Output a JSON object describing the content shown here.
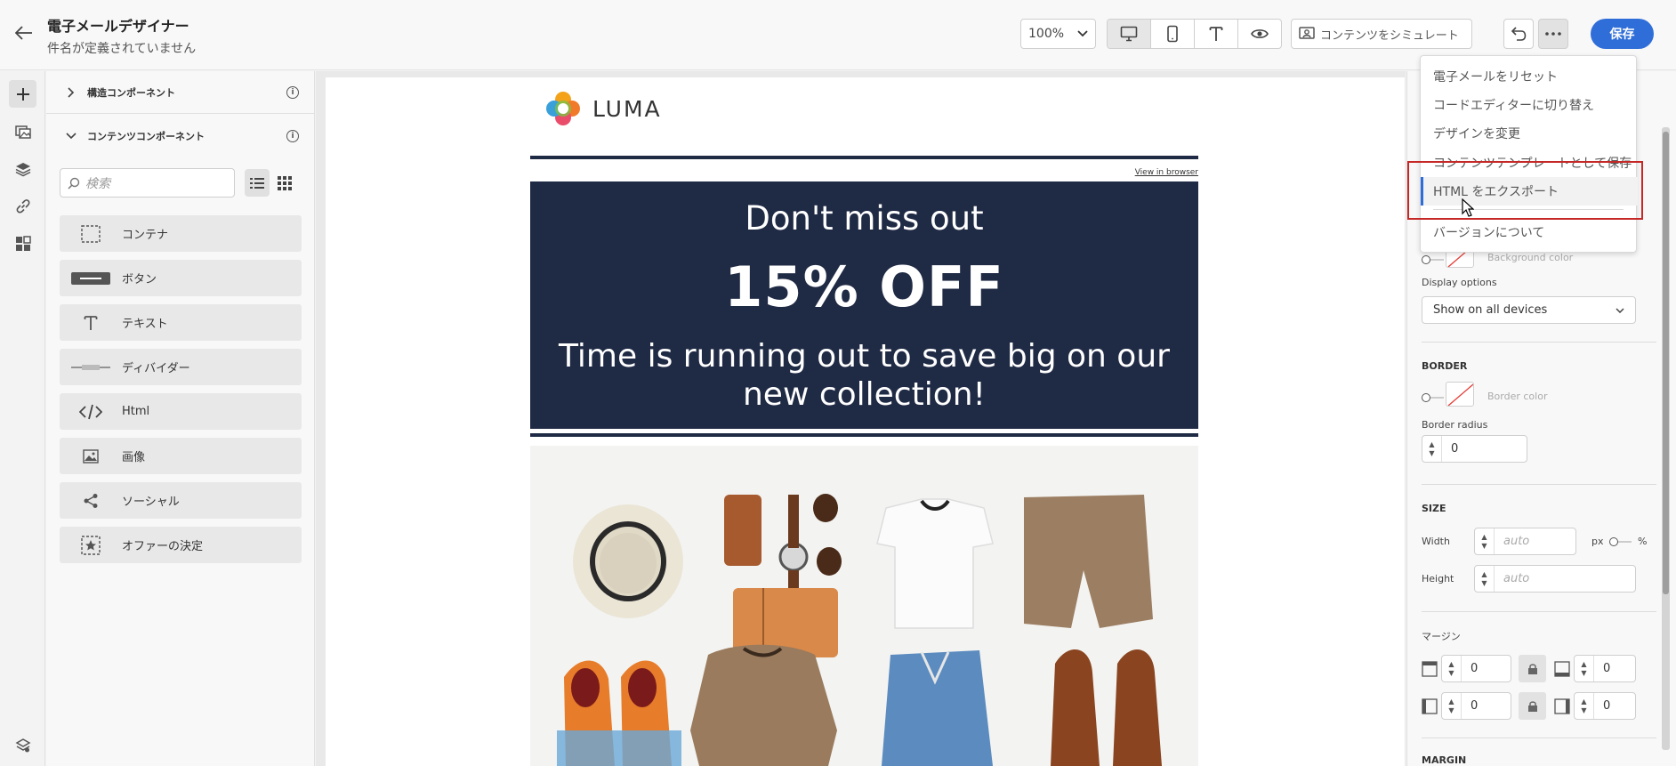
{
  "header": {
    "title": "電子メールデザイナー",
    "subtitle": "件名が定義されていません",
    "zoom": "100%",
    "simulate_label": "コンテンツをシミュレート",
    "save_label": "保存"
  },
  "components": {
    "structure_section": "構造コンポーネント",
    "content_section": "コンテンツコンポーネント",
    "search_placeholder": "検索",
    "items": [
      {
        "label": "コンテナ",
        "icon": "container-icon"
      },
      {
        "label": "ボタン",
        "icon": "button-icon"
      },
      {
        "label": "テキスト",
        "icon": "text-icon"
      },
      {
        "label": "ディバイダー",
        "icon": "divider-icon"
      },
      {
        "label": "Html",
        "icon": "html-icon"
      },
      {
        "label": "画像",
        "icon": "image-icon"
      },
      {
        "label": "ソーシャル",
        "icon": "social-icon"
      },
      {
        "label": "オファーの決定",
        "icon": "offer-decision-icon"
      }
    ]
  },
  "email": {
    "logo_text": "LUMA",
    "view_in_browser": "View in browser",
    "banner_line1": "Don't miss out",
    "banner_line2": "15% OFF",
    "banner_line3": "Time is running out to save big on our new collection!"
  },
  "menu": {
    "items": [
      "電子メールをリセット",
      "コードエディターに切り替え",
      "デザインを変更",
      "コンテンツテンプレートとして保存",
      "HTML をエクスポート",
      "バージョンについて"
    ],
    "highlighted": "HTML をエクスポート"
  },
  "properties": {
    "background_color_label": "Background color",
    "display_options_label": "Display options",
    "display_options_value": "Show on all devices",
    "border_heading": "BORDER",
    "border_color_label": "Border color",
    "border_radius_label": "Border radius",
    "border_radius_value": "0",
    "size_heading": "SIZE",
    "width_label": "Width",
    "width_placeholder": "auto",
    "width_unit_px": "px",
    "width_unit_pct": "%",
    "height_label": "Height",
    "height_placeholder": "auto",
    "margin_heading_jp": "マージン",
    "margin_top": "0",
    "margin_bottom": "0",
    "margin_left": "0",
    "margin_right": "0",
    "margin_heading": "MARGIN"
  },
  "colors": {
    "accent": "#2f6ed8",
    "banner_bg": "#1f2a44",
    "highlight_box": "#c62828"
  }
}
